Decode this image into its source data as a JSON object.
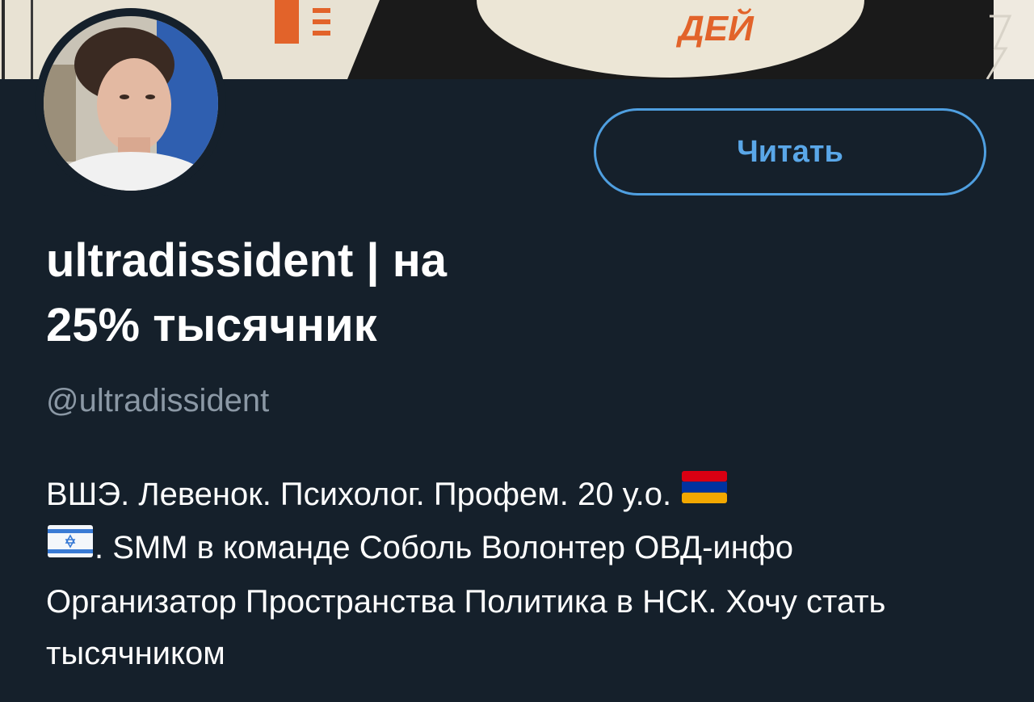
{
  "profile": {
    "display_name_line1": "ultradissident | на",
    "display_name_line2": "25% тысячник",
    "handle": "@ultradissident",
    "follow_button_label": "Читать"
  },
  "bio": {
    "part1": "ВШЭ. Левенок. Психолог. Профем. 20 у.о. ",
    "flag1": "armenia-flag-icon",
    "part2": ". SMM в команде Соболь Волонтер ОВД-инфо Организатор Пространства Политика в НСК. Хочу стать тысячником",
    "flag2": "israel-flag-icon"
  },
  "banner": {
    "visible_text": "ДЕЙ"
  },
  "colors": {
    "background": "#15202b",
    "accent": "#4f9fe0",
    "handle_text": "#8b98a5",
    "primary_text": "#ffffff"
  }
}
